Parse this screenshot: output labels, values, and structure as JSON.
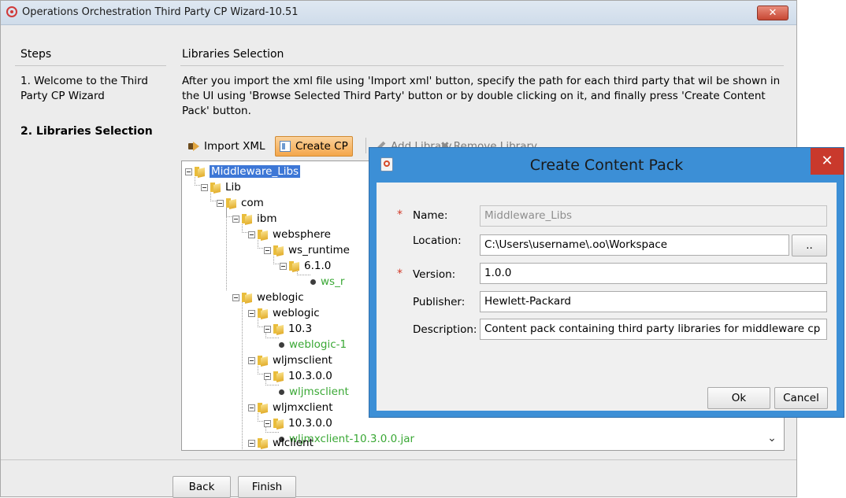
{
  "wizard": {
    "title": "Operations Orchestration Third Party CP Wizard-10.51",
    "close_glyph": "✕",
    "steps_header": "Steps",
    "steps": [
      {
        "label": "1. Welcome to the Third Party CP Wizard"
      },
      {
        "label": "2. Libraries Selection",
        "current": true
      }
    ],
    "section_title": "Libraries Selection",
    "instructions": "After you import the xml file using 'Import xml' button, specify the path for each third party that wil be shown in the UI using 'Browse Selected Third Party' button or by double clicking on it, and finally press 'Create Content Pack' button.",
    "toolbar": {
      "import_label": "Import XML",
      "create_label": "Create CP",
      "add_label": "Add Library",
      "remove_label": "Remove Library"
    },
    "tree": [
      {
        "label": "Middleware_Libs",
        "type": "folder",
        "selected": true
      },
      {
        "label": "Lib",
        "type": "folder"
      },
      {
        "label": "com",
        "type": "folder"
      },
      {
        "label": "ibm",
        "type": "folder"
      },
      {
        "label": "websphere",
        "type": "folder"
      },
      {
        "label": "ws_runtime",
        "type": "folder"
      },
      {
        "label": "6.1.0",
        "type": "folder"
      },
      {
        "label": "ws_r",
        "type": "leaf"
      },
      {
        "label": "weblogic",
        "type": "folder"
      },
      {
        "label": "weblogic",
        "type": "folder"
      },
      {
        "label": "10.3",
        "type": "folder"
      },
      {
        "label": "weblogic-1",
        "type": "leaf"
      },
      {
        "label": "wljmsclient",
        "type": "folder"
      },
      {
        "label": "10.3.0.0",
        "type": "folder"
      },
      {
        "label": "wljmsclient",
        "type": "leaf"
      },
      {
        "label": "wljmxclient",
        "type": "folder"
      },
      {
        "label": "10.3.0.0",
        "type": "folder"
      },
      {
        "label": "wljmxclient-10.3.0.0.jar",
        "type": "leaf"
      },
      {
        "label": "wlclient",
        "type": "folder"
      }
    ],
    "scroll_glyph": "⌄",
    "buttons": {
      "back": "Back",
      "finish": "Finish"
    }
  },
  "dialog": {
    "title": "Create Content Pack",
    "close_glyph": "✕",
    "required_marker": "*",
    "fields": {
      "name": {
        "label": "Name:",
        "value": "Middleware_Libs"
      },
      "location": {
        "label": "Location:",
        "value": "C:\\Users\\username\\.oo\\Workspace",
        "browse": ".."
      },
      "version": {
        "label": "Version:",
        "value": "1.0.0"
      },
      "publisher": {
        "label": "Publisher:",
        "value": "Hewlett-Packard"
      },
      "description": {
        "label": "Description:",
        "value": "Content pack containing third party libraries for middleware cp"
      }
    },
    "buttons": {
      "ok": "Ok",
      "cancel": "Cancel"
    }
  }
}
